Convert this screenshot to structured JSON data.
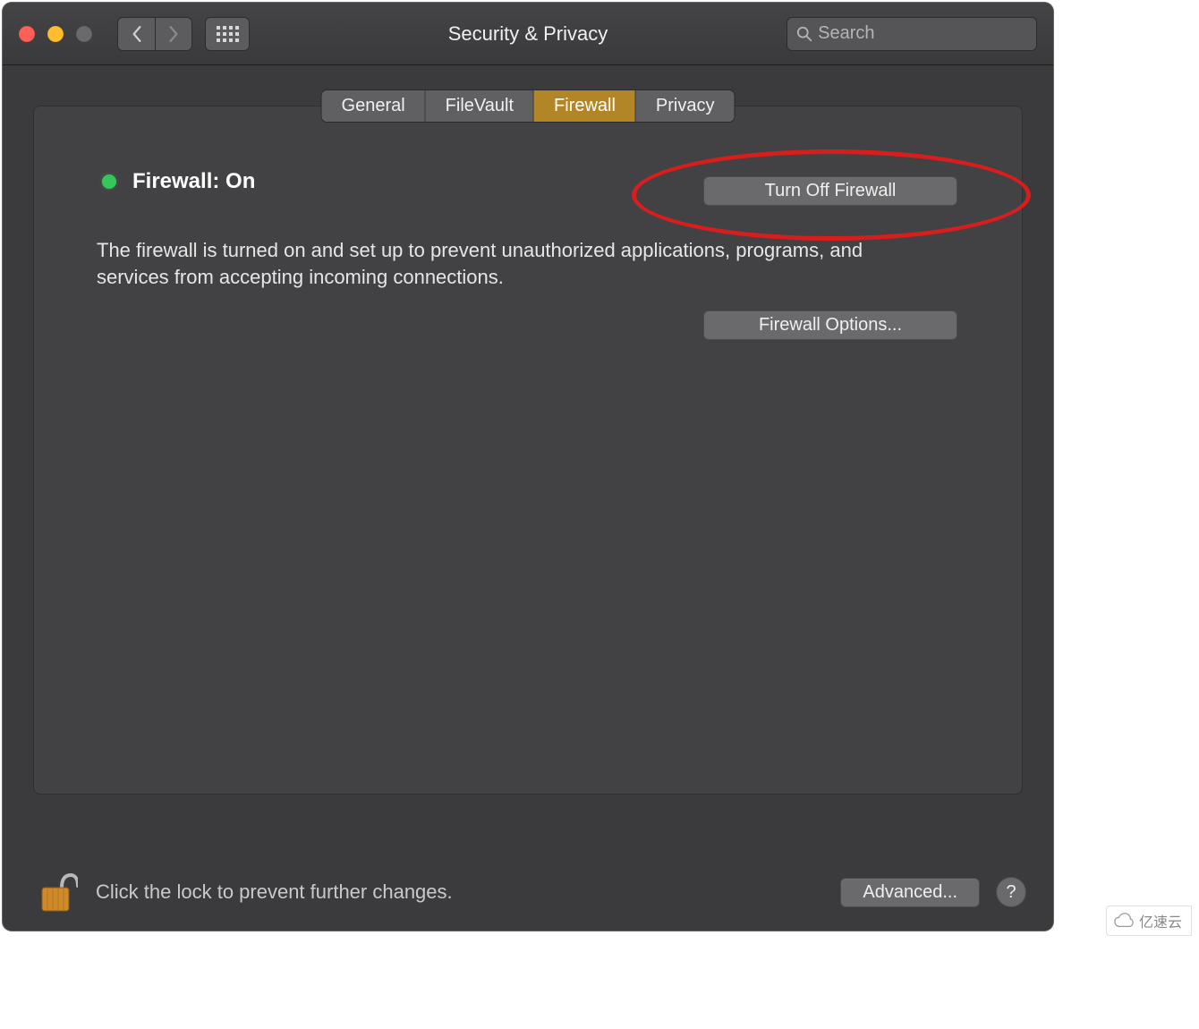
{
  "window": {
    "title": "Security & Privacy"
  },
  "toolbar": {
    "search_placeholder": "Search"
  },
  "tabs": [
    {
      "label": "General",
      "active": false
    },
    {
      "label": "FileVault",
      "active": false
    },
    {
      "label": "Firewall",
      "active": true
    },
    {
      "label": "Privacy",
      "active": false
    }
  ],
  "firewall": {
    "status_label": "Firewall: On",
    "status_color": "#35c759",
    "turn_off_label": "Turn Off Firewall",
    "description": "The firewall is turned on and set up to prevent unauthorized applications, programs, and services from accepting incoming connections.",
    "options_label": "Firewall Options..."
  },
  "footer": {
    "lock_text": "Click the lock to prevent further changes.",
    "advanced_label": "Advanced...",
    "help_label": "?"
  },
  "watermark": {
    "text": "亿速云"
  }
}
